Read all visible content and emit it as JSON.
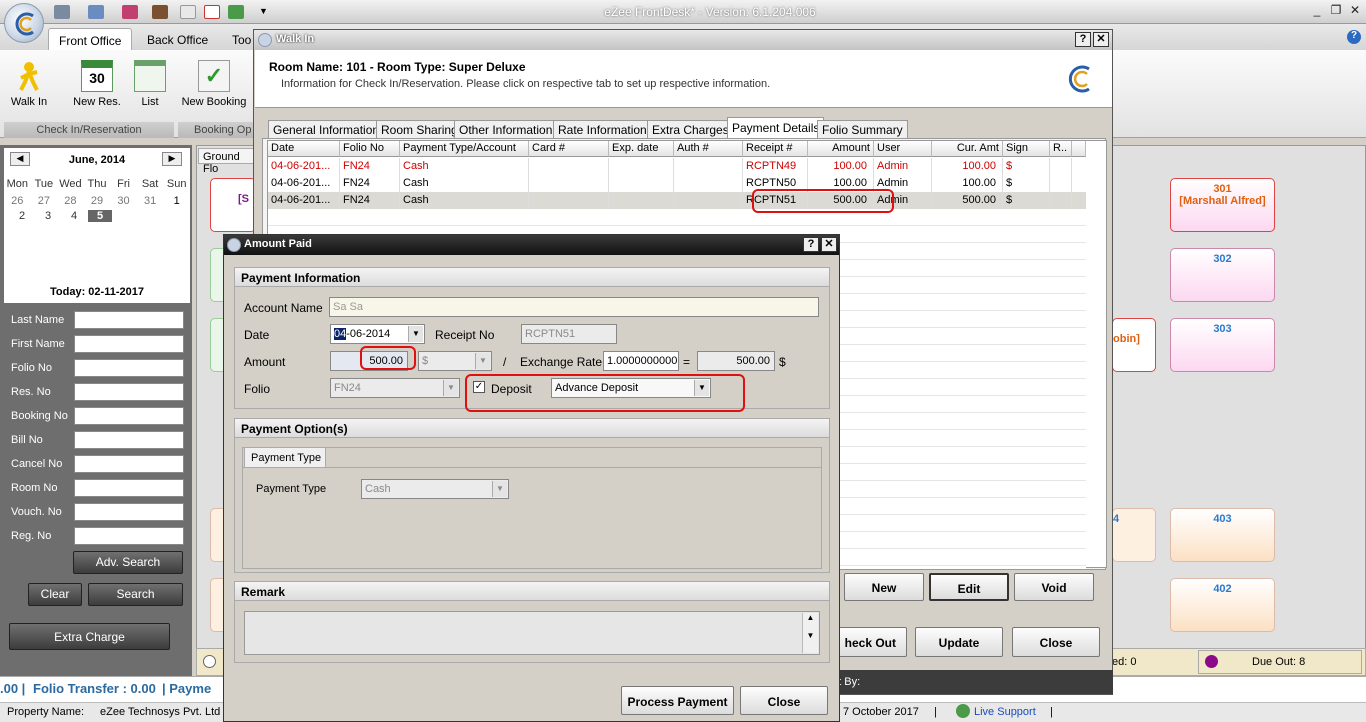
{
  "app": {
    "title": "eZee FrontDesk* - Version: 6.1.204.006",
    "ribbon_tabs": [
      "Front Office",
      "Back Office",
      "Too"
    ],
    "buttons": {
      "walk_in": "Walk In",
      "new_res": "New Res.",
      "list": "List",
      "new_booking": "New Booking"
    },
    "groups": {
      "checkin": "Check In/Reservation",
      "booking": "Booking Op"
    }
  },
  "calendar": {
    "month": "June, 2014",
    "days": [
      "Mon",
      "Tue",
      "Wed",
      "Thu",
      "Fri",
      "Sat",
      "Sun"
    ],
    "week1": [
      "26",
      "27",
      "28",
      "29",
      "30",
      "31",
      "1"
    ],
    "week2": [
      "2",
      "3",
      "4",
      "5"
    ],
    "today": "Today: 02-11-2017"
  },
  "search": {
    "fields": [
      "Last Name",
      "First Name",
      "Folio No",
      "Res. No",
      "Booking No",
      "Bill No",
      "Cancel No",
      "Room No",
      "Vouch. No",
      "Reg. No"
    ],
    "adv_search": "Adv. Search",
    "clear": "Clear",
    "search": "Search",
    "extra_charge": "Extra Charge"
  },
  "main": {
    "floor_label": "Ground Flo",
    "rooms": [
      {
        "num": "301",
        "guest": "[Marshall Alfred]"
      },
      {
        "num": "302",
        "guest": ""
      },
      {
        "num": "303",
        "guest": ""
      },
      {
        "num": "403",
        "guest": ""
      },
      {
        "num": "402",
        "guest": ""
      }
    ],
    "partial_room_text": "obin]",
    "partial_room_left_a": "[S",
    "partial_room_left_b": "4"
  },
  "status": {
    "due_out": "Due Out: 8",
    "other": "ed: 0"
  },
  "bottom": {
    "text_a": ".00 |",
    "folio_transfer": "Folio Transfer : 0.00",
    "payment": "| Payme"
  },
  "property": {
    "label": "Property Name:",
    "name": "eZee Technosys Pvt. Ltd",
    "date": "7 October 2017",
    "sep": "|",
    "live_support": "Live Support"
  },
  "walkin": {
    "title": "Walk In",
    "room_info": "Room Name: 101 - Room Type: Super Deluxe",
    "info": "Information for Check In/Reservation. Please click on respective tab to set up respective information.",
    "tabs": [
      "General Information",
      "Room Sharing",
      "Other Information",
      "Rate Information",
      "Extra Charges",
      "Payment Details",
      "Folio Summary"
    ],
    "columns": [
      "Date",
      "Folio No",
      "Payment Type/Account",
      "Card #",
      "Exp. date",
      "Auth #",
      "Receipt #",
      "Amount",
      "User",
      "Cur. Amt",
      "Sign",
      "R.."
    ],
    "rows": [
      {
        "date": "04-06-201...",
        "folio": "FN24",
        "type": "Cash",
        "receipt": "RCPTN49",
        "amount": "100.00",
        "user": "Admin",
        "cur_amt": "100.00",
        "sign": "$"
      },
      {
        "date": "04-06-201...",
        "folio": "FN24",
        "type": "Cash",
        "receipt": "RCPTN50",
        "amount": "100.00",
        "user": "Admin",
        "cur_amt": "100.00",
        "sign": "$"
      },
      {
        "date": "04-06-201...",
        "folio": "FN24",
        "type": "Cash",
        "receipt": "RCPTN51",
        "amount": "500.00",
        "user": "Admin",
        "cur_amt": "500.00",
        "sign": "$"
      }
    ],
    "buttons": {
      "new": "New",
      "edit": "Edit",
      "void": "Void",
      "check_out": "heck Out",
      "update": "Update",
      "close": "Close"
    },
    "footer": "ut By:"
  },
  "amount_paid": {
    "title": "Amount Paid",
    "payment_info": "Payment Information",
    "account_name_label": "Account Name",
    "account_name": "Sa Sa",
    "date_label": "Date",
    "date_sel": "04",
    "date_rest": "-06-2014",
    "receipt_label": "Receipt No",
    "receipt": "RCPTN51",
    "amount_label": "Amount",
    "amount": "500.00",
    "currency": "$",
    "slash": "/",
    "exchange_label": "Exchange Rate",
    "exchange": "1.0000000000",
    "equals": "=",
    "converted": "500.00",
    "conv_currency": "$",
    "folio_label": "Folio",
    "folio": "FN24",
    "deposit_label": "Deposit",
    "deposit_type": "Advance Deposit",
    "payment_options": "Payment Option(s)",
    "payment_type_tab": "Payment Type",
    "payment_type_label": "Payment Type",
    "payment_type": "Cash",
    "remark": "Remark",
    "process_payment": "Process Payment",
    "close": "Close"
  }
}
